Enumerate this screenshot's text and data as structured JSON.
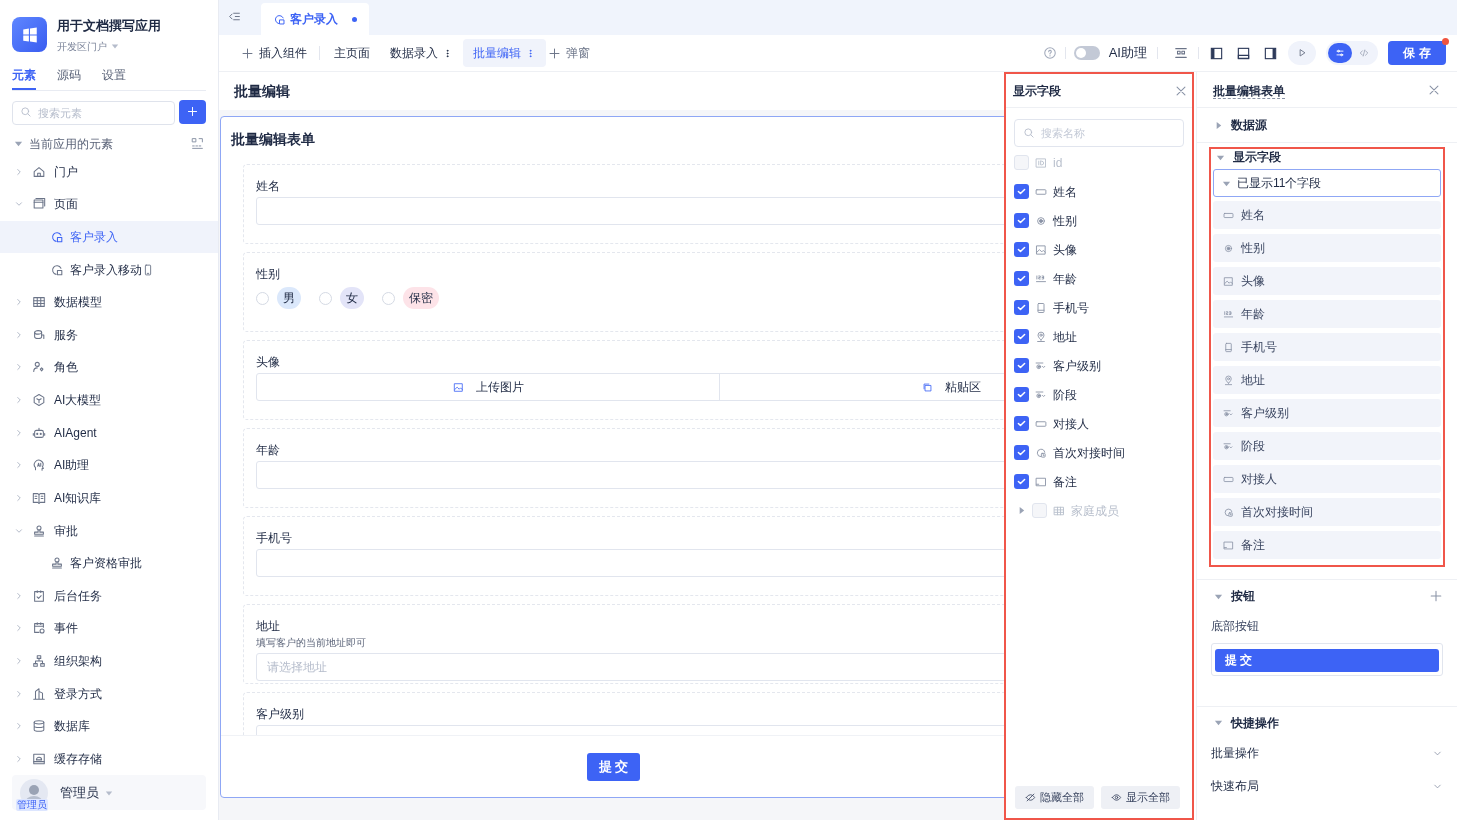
{
  "sidebar": {
    "app_title": "用于文档撰写应用",
    "app_subtitle": "开发区门户",
    "tabs": [
      {
        "label": "元素",
        "selected": true
      },
      {
        "label": "源码",
        "selected": false
      },
      {
        "label": "设置",
        "selected": false
      }
    ],
    "search": {
      "placeholder": "搜索元素"
    },
    "section_label": "当前应用的元素",
    "tree": [
      {
        "label": "门户",
        "kind": "home",
        "expanded": false
      },
      {
        "label": "页面",
        "kind": "page",
        "expanded": true,
        "children": [
          {
            "label": "客户录入",
            "kind": "form",
            "selected": true
          },
          {
            "label": "客户录入移动",
            "kind": "form",
            "selected": false,
            "mobile": true
          }
        ]
      },
      {
        "label": "数据模型",
        "kind": "table",
        "expanded": false
      },
      {
        "label": "服务",
        "kind": "service",
        "expanded": false
      },
      {
        "label": "角色",
        "kind": "role",
        "expanded": false
      },
      {
        "label": "AI大模型",
        "kind": "model",
        "expanded": false
      },
      {
        "label": "AIAgent",
        "kind": "agent",
        "expanded": false
      },
      {
        "label": "AI助理",
        "kind": "assistant",
        "expanded": false
      },
      {
        "label": "AI知识库",
        "kind": "book",
        "expanded": false
      },
      {
        "label": "审批",
        "kind": "approval",
        "expanded": true,
        "children": [
          {
            "label": "客户资格审批",
            "kind": "approval",
            "selected": false
          }
        ]
      },
      {
        "label": "后台任务",
        "kind": "task",
        "expanded": false
      },
      {
        "label": "事件",
        "kind": "event",
        "expanded": false
      },
      {
        "label": "组织架构",
        "kind": "org",
        "expanded": false
      },
      {
        "label": "登录方式",
        "kind": "login",
        "expanded": false
      },
      {
        "label": "数据库",
        "kind": "database",
        "expanded": false
      },
      {
        "label": "缓存存储",
        "kind": "storage",
        "expanded": false
      }
    ],
    "user": {
      "name": "管理员",
      "badge": "管理员"
    }
  },
  "editor_tab": {
    "label": "客户录入",
    "modified": true
  },
  "toolbar": {
    "insert_label": "插入组件",
    "pages": [
      {
        "label": "主页面",
        "selected": false,
        "menu": false
      },
      {
        "label": "数据录入",
        "selected": false,
        "menu": true
      },
      {
        "label": "批量编辑",
        "selected": true,
        "menu": true
      }
    ],
    "add_dialog_label": "弹窗",
    "assistant": {
      "label": "AI助理",
      "on": false
    },
    "layout_toggles": [
      {
        "kind": "left",
        "on": true
      },
      {
        "kind": "bottom",
        "on": false
      },
      {
        "kind": "right",
        "on": true
      }
    ],
    "view_modes": [
      {
        "kind": "design",
        "selected": true
      },
      {
        "kind": "code",
        "selected": false
      }
    ],
    "save": {
      "label": "保 存",
      "unsaved": true
    }
  },
  "canvas": {
    "page_title": "批量编辑",
    "form_title": "批量编辑表单",
    "fields": [
      {
        "kind": "input",
        "label": "姓名"
      },
      {
        "kind": "radio",
        "label": "性别",
        "options": [
          {
            "label": "男",
            "color": "#dbe8fb"
          },
          {
            "label": "女",
            "color": "#e3e4f8"
          },
          {
            "label": "保密",
            "color": "#fde3e8"
          }
        ]
      },
      {
        "kind": "upload",
        "label": "头像",
        "upload_label": "上传图片",
        "paste_label": "粘贴区"
      },
      {
        "kind": "input",
        "label": "年龄"
      },
      {
        "kind": "input",
        "label": "手机号"
      },
      {
        "kind": "input",
        "label": "地址",
        "hint": "填写客户的当前地址即可",
        "placeholder": "请选择地址"
      },
      {
        "kind": "input",
        "label": "客户级别"
      }
    ],
    "submit_label": "提 交"
  },
  "fields_panel": {
    "title": "显示字段",
    "highlighted": true,
    "search_placeholder": "搜索名称",
    "fields": [
      {
        "label": "id",
        "kind": "id",
        "checked": false,
        "disabled": true
      },
      {
        "label": "姓名",
        "kind": "text",
        "checked": true,
        "disabled": false
      },
      {
        "label": "性别",
        "kind": "radio",
        "checked": true,
        "disabled": false
      },
      {
        "label": "头像",
        "kind": "image",
        "checked": true,
        "disabled": false
      },
      {
        "label": "年龄",
        "kind": "number",
        "checked": true,
        "disabled": false
      },
      {
        "label": "手机号",
        "kind": "phone",
        "checked": true,
        "disabled": false
      },
      {
        "label": "地址",
        "kind": "location",
        "checked": true,
        "disabled": false
      },
      {
        "label": "客户级别",
        "kind": "select",
        "checked": true,
        "disabled": false
      },
      {
        "label": "阶段",
        "kind": "select",
        "checked": true,
        "disabled": false
      },
      {
        "label": "对接人",
        "kind": "text",
        "checked": true,
        "disabled": false
      },
      {
        "label": "首次对接时间",
        "kind": "date",
        "checked": true,
        "disabled": false
      },
      {
        "label": "备注",
        "kind": "textarea",
        "checked": true,
        "disabled": false
      },
      {
        "label": "家庭成员",
        "kind": "table",
        "checked": false,
        "disabled": true,
        "expandable": true
      }
    ],
    "hide_all_label": "隐藏全部",
    "show_all_label": "显示全部"
  },
  "props_panel": {
    "title": "批量编辑表单",
    "sections": [
      {
        "kind": "plain",
        "title": "数据源",
        "expanded": false
      },
      {
        "kind": "fields",
        "title": "显示字段",
        "expanded": true,
        "highlighted": true,
        "summary": "已显示11个字段",
        "fields": [
          {
            "label": "姓名",
            "kind": "text"
          },
          {
            "label": "性别",
            "kind": "radio"
          },
          {
            "label": "头像",
            "kind": "image"
          },
          {
            "label": "年龄",
            "kind": "number"
          },
          {
            "label": "手机号",
            "kind": "phone"
          },
          {
            "label": "地址",
            "kind": "location"
          },
          {
            "label": "客户级别",
            "kind": "select"
          },
          {
            "label": "阶段",
            "kind": "select"
          },
          {
            "label": "对接人",
            "kind": "text"
          },
          {
            "label": "首次对接时间",
            "kind": "date"
          },
          {
            "label": "备注",
            "kind": "textarea"
          }
        ]
      },
      {
        "kind": "buttons",
        "title": "按钮",
        "expanded": true,
        "sub_label": "底部按钮",
        "button_label": "提 交"
      },
      {
        "kind": "actions",
        "title": "快捷操作",
        "expanded": true,
        "items": [
          "批量操作",
          "快速布局"
        ]
      }
    ]
  }
}
